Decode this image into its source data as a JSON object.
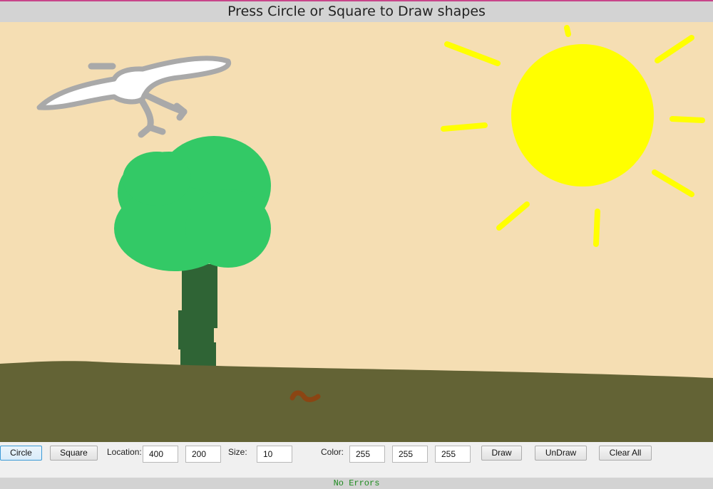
{
  "title": "Press Circle or Square to Draw shapes",
  "colors": {
    "sky": "#f5deb3",
    "ground": "#636335",
    "sun": "#ffff00",
    "tree_foliage": "#33c966",
    "tree_trunk": "#2f6435",
    "bird_outline": "#a9a9a9",
    "bird_body": "#ffffff",
    "worm": "#8b4513",
    "status_text": "#1e8a1e"
  },
  "scene": {
    "elements": [
      "sun",
      "sun-rays",
      "bird",
      "tree-foliage",
      "tree-trunk",
      "ground",
      "worm"
    ]
  },
  "toolbar": {
    "circle_label": "Circle",
    "square_label": "Square",
    "location_label": "Location:",
    "location_x": "400",
    "location_y": "200",
    "size_label": "Size:",
    "size_value": "10",
    "color_label": "Color:",
    "color_r": "255",
    "color_g": "255",
    "color_b": "255",
    "draw_label": "Draw",
    "undraw_label": "UnDraw",
    "clear_label": "Clear All"
  },
  "status": "No Errors"
}
